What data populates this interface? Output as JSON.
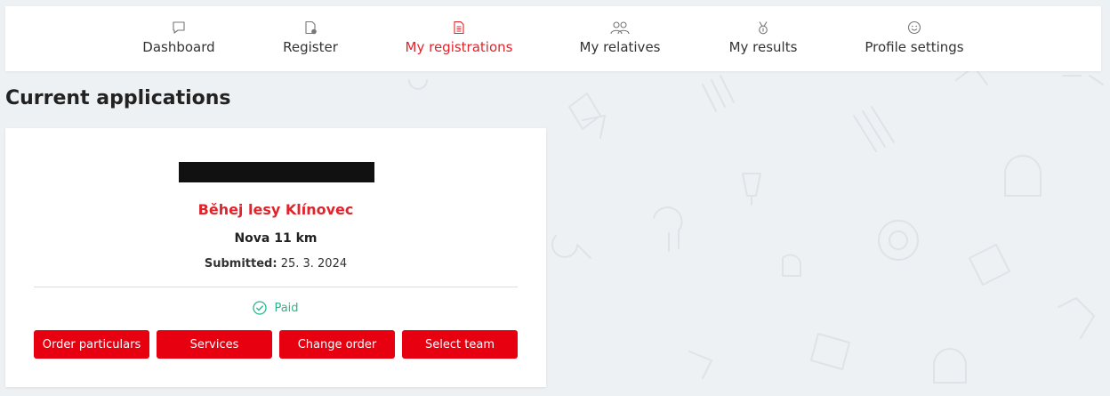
{
  "nav": {
    "items": [
      {
        "label": "Dashboard",
        "icon": "chat-bubble-icon",
        "active": false
      },
      {
        "label": "Register",
        "icon": "document-add-icon",
        "active": false
      },
      {
        "label": "My registrations",
        "icon": "document-list-icon",
        "active": true
      },
      {
        "label": "My relatives",
        "icon": "users-icon",
        "active": false
      },
      {
        "label": "My results",
        "icon": "medal-icon",
        "active": false
      },
      {
        "label": "Profile settings",
        "icon": "smiley-icon",
        "active": false
      }
    ]
  },
  "page": {
    "title": "Current applications"
  },
  "application": {
    "event_title": "Běhej lesy Klínovec",
    "race_name": "Nova 11 km",
    "submitted_label": "Submitted:",
    "submitted_date": "25. 3. 2024",
    "status": "Paid",
    "buttons": {
      "order_particulars": "Order particulars",
      "services": "Services",
      "change_order": "Change order",
      "select_team": "Select team"
    }
  },
  "colors": {
    "accent": "#e0242b",
    "button": "#e60010",
    "paid": "#2bb58a",
    "background": "#eef1f4"
  }
}
